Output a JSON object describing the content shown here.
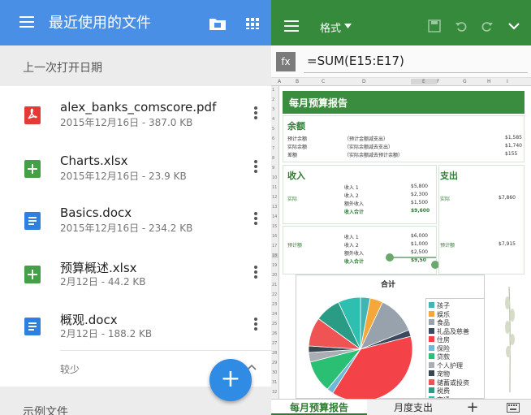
{
  "left": {
    "title": "最近使用的文件",
    "section": "上一次打开日期",
    "files": [
      {
        "name": "alex_banks_comscore.pdf",
        "meta": "2015年12月16日 - 387.0 KB",
        "type": "pdf",
        "color": "#e53935"
      },
      {
        "name": "Charts.xlsx",
        "meta": "2015年12月16日 - 23.9 KB",
        "type": "xlsx",
        "color": "#43a047"
      },
      {
        "name": "Basics.docx",
        "meta": "2015年12月16日 - 234.2 KB",
        "type": "docx",
        "color": "#2f7fe0"
      },
      {
        "name": "预算概述.xlsx",
        "meta": "2月12日 - 44.2 KB",
        "type": "xlsx",
        "color": "#43a047"
      },
      {
        "name": "概观.docx",
        "meta": "2月12日 - 188.2 KB",
        "type": "docx",
        "color": "#2f7fe0"
      }
    ],
    "less": "较少",
    "section2": "示例文件",
    "fab": "+"
  },
  "right": {
    "format_menu": "格式",
    "fx_label": "fx",
    "formula": "=SUM(E15:E17)",
    "columns": [
      "A",
      "B",
      "C",
      "D",
      "E",
      "F",
      "G",
      "H",
      "I"
    ],
    "rows": [
      "1",
      "2",
      "3",
      "4",
      "5",
      "6",
      "7",
      "8",
      "9",
      "10",
      "11",
      "12",
      "13",
      "14",
      "15",
      "16",
      "17",
      "18",
      "19",
      "20",
      "21",
      "22",
      "23",
      "24",
      "25",
      "26",
      "27",
      "28",
      "29",
      "30",
      "31",
      "32"
    ],
    "sheet_title": "每月预算报告",
    "balance": {
      "title": "余额",
      "rows": [
        {
          "label": "预计余额",
          "desc": "（预计金额减支出）",
          "value": "$1,585"
        },
        {
          "label": "实际余额",
          "desc": "（实际余额减去支出）",
          "value": "$1,740"
        },
        {
          "label": "差额",
          "desc": "（实际余额减去预计余额）",
          "value": "$155"
        }
      ]
    },
    "income": {
      "title": "收入",
      "actual_label": "实际",
      "actual": [
        {
          "label": "收入 1",
          "value": "$5,800"
        },
        {
          "label": "收入 2",
          "value": "$2,300"
        },
        {
          "label": "额外收入",
          "value": "$1,500"
        },
        {
          "label": "收入合计",
          "value": "$9,600"
        }
      ],
      "planned_label": "预计额",
      "planned": [
        {
          "label": "收入 1",
          "value": "$6,000"
        },
        {
          "label": "收入 2",
          "value": "$1,000"
        },
        {
          "label": "额外收入",
          "value": "$2,500"
        },
        {
          "label": "收入合计",
          "value": "$9,50"
        }
      ]
    },
    "expense": {
      "title": "支出",
      "actual_label": "实际",
      "actual_value": "$7,860",
      "planned_label": "预计额",
      "planned_value": "$7,915"
    },
    "chart_data": {
      "type": "pie",
      "title": "合计",
      "categories": [
        "孩子",
        "娱乐",
        "食品",
        "礼品及慈善",
        "住房",
        "保险",
        "贷款",
        "个人护理",
        "宠物",
        "储蓄或投资",
        "税费",
        "交通"
      ],
      "values": [
        3,
        4,
        12,
        2,
        38,
        2,
        10,
        3,
        2,
        9,
        8,
        7
      ],
      "colors": [
        "#3fb6b3",
        "#f5a73b",
        "#98a2ad",
        "#3b4a5e",
        "#f44348",
        "#6fb8d9",
        "#2bbf73",
        "#a9adb4",
        "#37474f",
        "#f05353",
        "#2a9c86",
        "#2fbfb0"
      ]
    },
    "tabs": [
      "每月预算报告",
      "月度支出",
      "+"
    ]
  }
}
